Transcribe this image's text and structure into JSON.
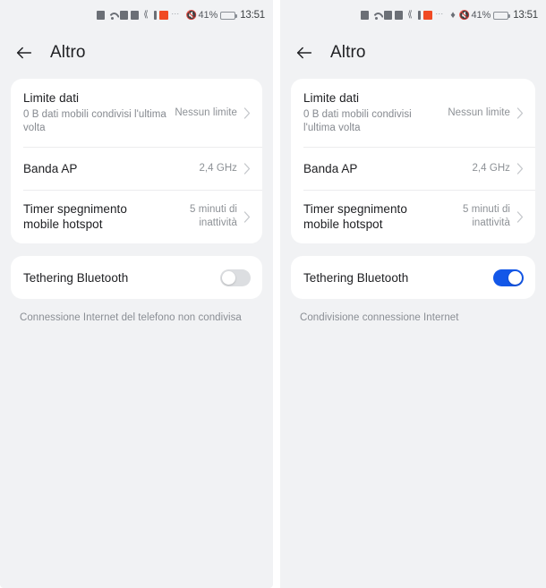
{
  "theme": {
    "background": "#f1f2f4",
    "card": "#ffffff",
    "accent_on": "#1357e8",
    "toggle_off": "#dcdee1",
    "title_color": "#202124",
    "secondary_text": "#85898f",
    "notification_accent": "#f04a23"
  },
  "panels": [
    {
      "id": "left",
      "status_bar": {
        "notification_icons": [
          "battery-saver-icon",
          "wifi-icon",
          "email-icon",
          "battery-icon",
          "twitter-icon",
          "alert-icon",
          "app-red-icon",
          "overflow-dots-icon"
        ],
        "system_icons": [
          "mute-icon"
        ],
        "battery_percent": "41%",
        "battery_level": 41,
        "time": "13:51"
      },
      "appbar": {
        "back_icon": "back-arrow-icon",
        "title": "Altro"
      },
      "settings_card": {
        "rows": [
          {
            "title": "Limite dati",
            "subtitle": "0 B dati mobili condivisi l'ultima volta",
            "value": "Nessun limite",
            "chevron": "chevron-right-icon"
          },
          {
            "title": "Banda AP",
            "subtitle": "",
            "value": "2,4 GHz",
            "chevron": "chevron-right-icon"
          },
          {
            "title": "Timer spegnimento mobile hotspot",
            "subtitle": "",
            "value": "5 minuti di inattività",
            "chevron": "chevron-right-icon"
          }
        ]
      },
      "bluetooth_card": {
        "title": "Tethering Bluetooth",
        "enabled": false
      },
      "footnote": "Connessione Internet del telefono non condivisa"
    },
    {
      "id": "right",
      "status_bar": {
        "notification_icons": [
          "battery-saver-icon",
          "wifi-icon",
          "email-icon",
          "battery-icon",
          "twitter-icon",
          "alert-icon",
          "app-red-icon",
          "overflow-dots-icon"
        ],
        "system_icons": [
          "bluetooth-icon",
          "mute-icon"
        ],
        "battery_percent": "41%",
        "battery_level": 41,
        "time": "13:51"
      },
      "appbar": {
        "back_icon": "back-arrow-icon",
        "title": "Altro"
      },
      "settings_card": {
        "rows": [
          {
            "title": "Limite dati",
            "subtitle": "0 B dati mobili condivisi l'ultima volta",
            "value": "Nessun limite",
            "chevron": "chevron-right-icon"
          },
          {
            "title": "Banda AP",
            "subtitle": "",
            "value": "2,4 GHz",
            "chevron": "chevron-right-icon"
          },
          {
            "title": "Timer spegnimento mobile hotspot",
            "subtitle": "",
            "value": "5 minuti di inattività",
            "chevron": "chevron-right-icon"
          }
        ]
      },
      "bluetooth_card": {
        "title": "Tethering Bluetooth",
        "enabled": true
      },
      "footnote": "Condivisione connessione Internet"
    }
  ]
}
